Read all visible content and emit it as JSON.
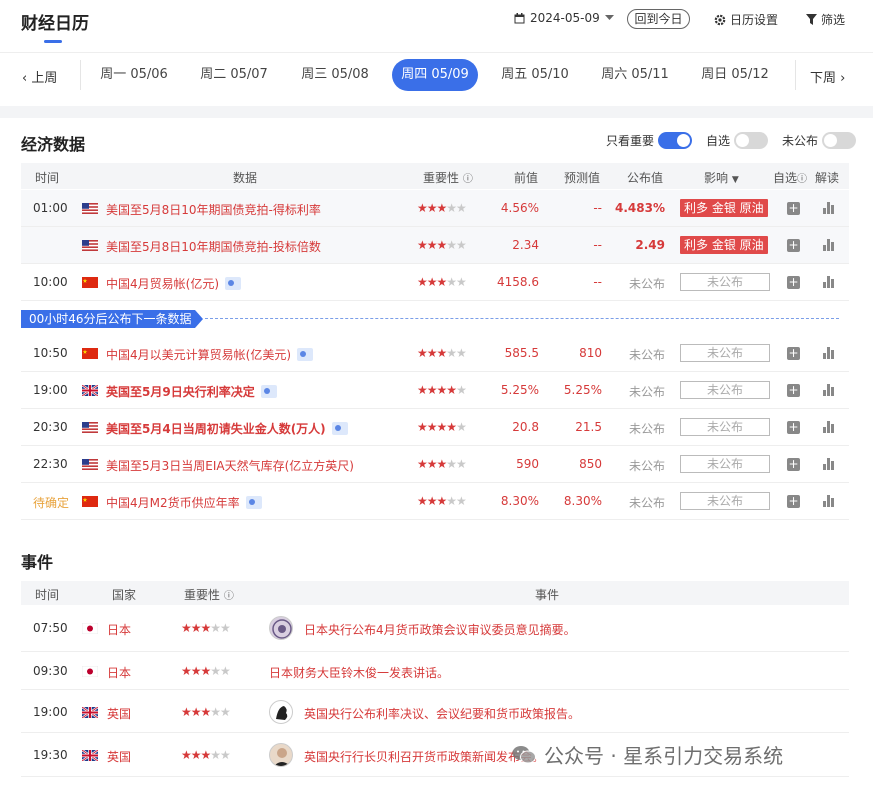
{
  "header": {
    "title": "财经日历",
    "date": "2024-05-09",
    "today_button": "回到今日",
    "settings": "日历设置",
    "filter": "筛选"
  },
  "week": {
    "prev": "上周",
    "next": "下周",
    "days": [
      {
        "label": "周一 05/06",
        "active": false
      },
      {
        "label": "周二 05/07",
        "active": false
      },
      {
        "label": "周三 05/08",
        "active": false
      },
      {
        "label": "周四 05/09",
        "active": true
      },
      {
        "label": "周五 05/10",
        "active": false
      },
      {
        "label": "周六 05/11",
        "active": false
      },
      {
        "label": "周日 05/12",
        "active": false
      }
    ]
  },
  "economic": {
    "title": "经济数据",
    "toggles": {
      "important_only": "只看重要",
      "watchlist": "自选",
      "unpublished": "未公布"
    },
    "columns": {
      "time": "时间",
      "data": "数据",
      "importance": "重要性",
      "previous": "前值",
      "forecast": "预测值",
      "actual": "公布值",
      "impact": "影响",
      "watch": "自选",
      "analysis": "解读"
    },
    "countdown": "00小时46分后公布下一条数据",
    "rows": [
      {
        "time": "01:00",
        "flag": "us",
        "name": "美国至5月8日10年期国债竞拍-得标利率",
        "stars": 3,
        "previous": "4.56%",
        "forecast": "--",
        "actual": "4.483%",
        "impact": "利多 金银 原油",
        "bold": false,
        "doc": false
      },
      {
        "time": "",
        "flag": "us",
        "name": "美国至5月8日10年期国债竞拍-投标倍数",
        "stars": 3,
        "previous": "2.34",
        "forecast": "--",
        "actual": "2.49",
        "impact": "利多 金银 原油",
        "bold": false,
        "doc": false
      },
      {
        "time": "10:00",
        "flag": "cn",
        "name": "中国4月贸易帐(亿元)",
        "stars": 3,
        "previous": "4158.6",
        "forecast": "--",
        "actual": "未公布",
        "impact": "未公布",
        "bold": false,
        "doc": true
      },
      {
        "time": "10:50",
        "flag": "cn",
        "name": "中国4月以美元计算贸易帐(亿美元)",
        "stars": 3,
        "previous": "585.5",
        "forecast": "810",
        "actual": "未公布",
        "impact": "未公布",
        "bold": false,
        "doc": true
      },
      {
        "time": "19:00",
        "flag": "uk",
        "name": "英国至5月9日央行利率决定",
        "stars": 4,
        "previous": "5.25%",
        "forecast": "5.25%",
        "actual": "未公布",
        "impact": "未公布",
        "bold": true,
        "doc": true
      },
      {
        "time": "20:30",
        "flag": "us",
        "name": "美国至5月4日当周初请失业金人数(万人)",
        "stars": 4,
        "previous": "20.8",
        "forecast": "21.5",
        "actual": "未公布",
        "impact": "未公布",
        "bold": true,
        "doc": true
      },
      {
        "time": "22:30",
        "flag": "us",
        "name": "美国至5月3日当周EIA天然气库存(亿立方英尺)",
        "stars": 3,
        "previous": "590",
        "forecast": "850",
        "actual": "未公布",
        "impact": "未公布",
        "bold": false,
        "doc": false
      },
      {
        "time": "待确定",
        "flag": "cn",
        "name": "中国4月M2货币供应年率",
        "stars": 3,
        "previous": "8.30%",
        "forecast": "8.30%",
        "actual": "未公布",
        "impact": "未公布",
        "bold": false,
        "doc": true
      }
    ]
  },
  "events": {
    "title": "事件",
    "columns": {
      "time": "时间",
      "country": "国家",
      "importance": "重要性",
      "event": "事件"
    },
    "rows": [
      {
        "time": "07:50",
        "flag": "jp",
        "country": "日本",
        "stars": 3,
        "text": "日本央行公布4月货币政策会议审议委员意见摘要。",
        "avatar": "seal"
      },
      {
        "time": "09:30",
        "flag": "jp",
        "country": "日本",
        "stars": 3,
        "text": "日本财务大臣铃木俊一发表讲话。",
        "avatar": ""
      },
      {
        "time": "19:00",
        "flag": "uk",
        "country": "英国",
        "stars": 3,
        "text": "英国央行公布利率决议、会议纪要和货币政策报告。",
        "avatar": "logo"
      },
      {
        "time": "19:30",
        "flag": "uk",
        "country": "英国",
        "stars": 3,
        "text": "英国央行行长贝利召开货币政策新闻发布会。",
        "avatar": "person"
      }
    ]
  },
  "watermark": "公众号 · 星系引力交易系统"
}
